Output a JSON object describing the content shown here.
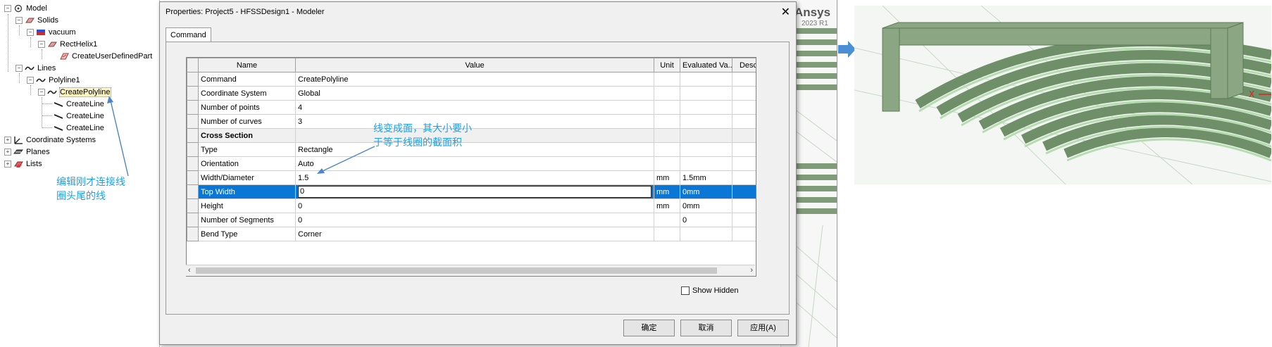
{
  "tree": {
    "items": [
      {
        "label": "Model"
      },
      {
        "label": "Solids"
      },
      {
        "label": "vacuum"
      },
      {
        "label": "RectHelix1"
      },
      {
        "label": "CreateUserDefinedPart"
      },
      {
        "label": "Lines"
      },
      {
        "label": "Polyline1"
      },
      {
        "label": "CreatePolyline"
      },
      {
        "label": "CreateLine"
      },
      {
        "label": "CreateLine"
      },
      {
        "label": "CreateLine"
      },
      {
        "label": "Coordinate Systems"
      },
      {
        "label": "Planes"
      },
      {
        "label": "Lists"
      }
    ]
  },
  "annotations": {
    "left_line1": "编辑刚才连接线",
    "left_line2": "圈头尾的线",
    "center_line1": "线变成面，其大小要小",
    "center_line2": "于等于线圈的截面积"
  },
  "background": {
    "ansys_logo": "Ansys",
    "ansys_version": "2023 R1"
  },
  "dialog": {
    "title": "Properties: Project5 - HFSSDesign1 - Modeler",
    "close_icon": "close-icon",
    "tab": "Command",
    "columns": [
      "Name",
      "Value",
      "Unit",
      "Evaluated Va...",
      "Desc"
    ],
    "rows": [
      {
        "name": "Command",
        "value": "CreatePolyline",
        "unit": "",
        "evaluated": ""
      },
      {
        "name": "Coordinate System",
        "value": "Global",
        "unit": "",
        "evaluated": ""
      },
      {
        "name": "Number of points",
        "value": "4",
        "unit": "",
        "evaluated": ""
      },
      {
        "name": "Number of curves",
        "value": "3",
        "unit": "",
        "evaluated": ""
      },
      {
        "name": "Cross Section",
        "value": "",
        "unit": "",
        "evaluated": "",
        "section": true
      },
      {
        "name": "Type",
        "value": "Rectangle",
        "unit": "",
        "evaluated": ""
      },
      {
        "name": "Orientation",
        "value": "Auto",
        "unit": "",
        "evaluated": ""
      },
      {
        "name": "Width/Diameter",
        "value": "1.5",
        "unit": "mm",
        "evaluated": "1.5mm"
      },
      {
        "name": "Top Width",
        "value": "0",
        "unit": "mm",
        "evaluated": "0mm",
        "selected": true
      },
      {
        "name": "Height",
        "value": "0",
        "unit": "mm",
        "evaluated": "0mm"
      },
      {
        "name": "Number of Segments",
        "value": "0",
        "unit": "",
        "evaluated": "0"
      },
      {
        "name": "Bend Type",
        "value": "Corner",
        "unit": "",
        "evaluated": ""
      }
    ],
    "show_hidden": "Show Hidden",
    "buttons": {
      "ok": "确定",
      "cancel": "取消",
      "apply": "应用(A)"
    }
  },
  "colors": {
    "selection": "#0a77d6",
    "annotation": "#1ea0e6",
    "coil": "#7e9c77"
  }
}
